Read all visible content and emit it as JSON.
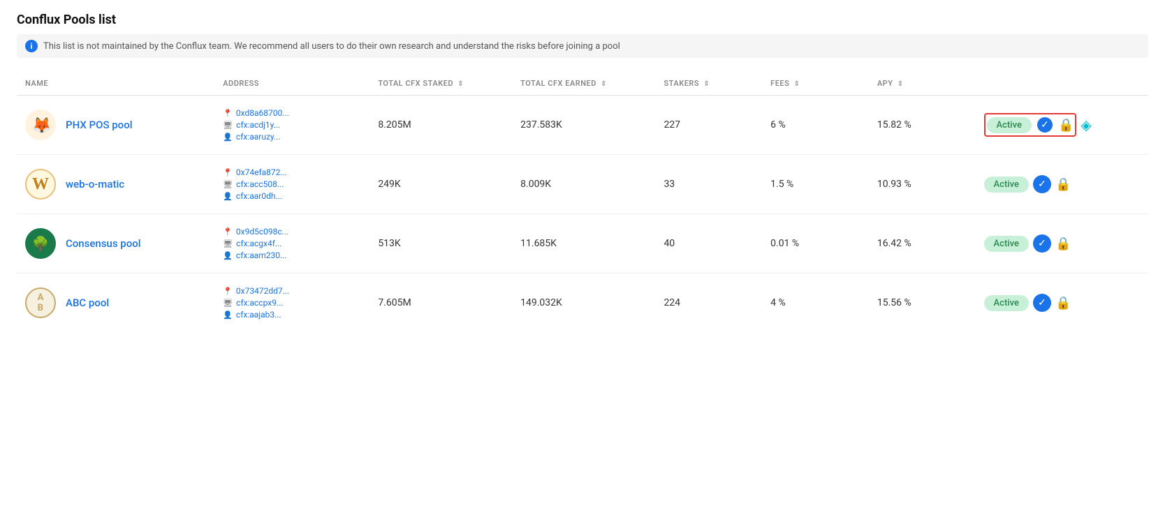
{
  "page": {
    "title": "Conflux Pools list",
    "info_message": "This list is not maintained by the Conflux team. We recommend all users to do their own research and understand the risks before joining a pool"
  },
  "table": {
    "columns": [
      {
        "key": "name",
        "label": "NAME",
        "sortable": false
      },
      {
        "key": "address",
        "label": "ADDRESS",
        "sortable": false
      },
      {
        "key": "total_cfx_staked",
        "label": "TOTAL CFX STAKED",
        "sortable": true
      },
      {
        "key": "total_cfx_earned",
        "label": "TOTAL CFX EARNED",
        "sortable": true
      },
      {
        "key": "stakers",
        "label": "STAKERS",
        "sortable": true
      },
      {
        "key": "fees",
        "label": "FEES",
        "sortable": true
      },
      {
        "key": "apy",
        "label": "APY",
        "sortable": true
      }
    ],
    "rows": [
      {
        "id": "phx",
        "name": "PHX POS pool",
        "logo_type": "phx",
        "logo_emoji": "🦊",
        "address_hex": "0xd8a68700...",
        "address_cfx1": "cfx:acdj1y...",
        "address_cfx2": "cfx:aaruzy...",
        "total_cfx_staked": "8.205M",
        "total_cfx_earned": "237.583K",
        "stakers": "227",
        "fees": "6 %",
        "apy": "15.82 %",
        "status": "Active",
        "verified": true,
        "locked": true,
        "has_diamond": true,
        "highlight": true
      },
      {
        "id": "web-o-matic",
        "name": "web-o-matic",
        "logo_type": "web",
        "logo_emoji": "W",
        "address_hex": "0x74efa872...",
        "address_cfx1": "cfx:acc508...",
        "address_cfx2": "cfx:aar0dh...",
        "total_cfx_staked": "249K",
        "total_cfx_earned": "8.009K",
        "stakers": "33",
        "fees": "1.5 %",
        "apy": "10.93 %",
        "status": "Active",
        "verified": true,
        "locked": true,
        "has_diamond": false,
        "highlight": false
      },
      {
        "id": "consensus",
        "name": "Consensus pool",
        "logo_type": "consensus",
        "logo_emoji": "🌳",
        "address_hex": "0x9d5c098c...",
        "address_cfx1": "cfx:acgx4f...",
        "address_cfx2": "cfx:aam230...",
        "total_cfx_staked": "513K",
        "total_cfx_earned": "11.685K",
        "stakers": "40",
        "fees": "0.01 %",
        "apy": "16.42 %",
        "status": "Active",
        "verified": true,
        "locked": true,
        "has_diamond": false,
        "highlight": false
      },
      {
        "id": "abc",
        "name": "ABC pool",
        "logo_type": "abc",
        "logo_emoji": "AB",
        "address_hex": "0x73472dd7...",
        "address_cfx1": "cfx:accpx9...",
        "address_cfx2": "cfx:aajab3...",
        "total_cfx_staked": "7.605M",
        "total_cfx_earned": "149.032K",
        "stakers": "224",
        "fees": "4 %",
        "apy": "15.56 %",
        "status": "Active",
        "verified": true,
        "locked": true,
        "has_diamond": false,
        "highlight": false
      }
    ]
  }
}
